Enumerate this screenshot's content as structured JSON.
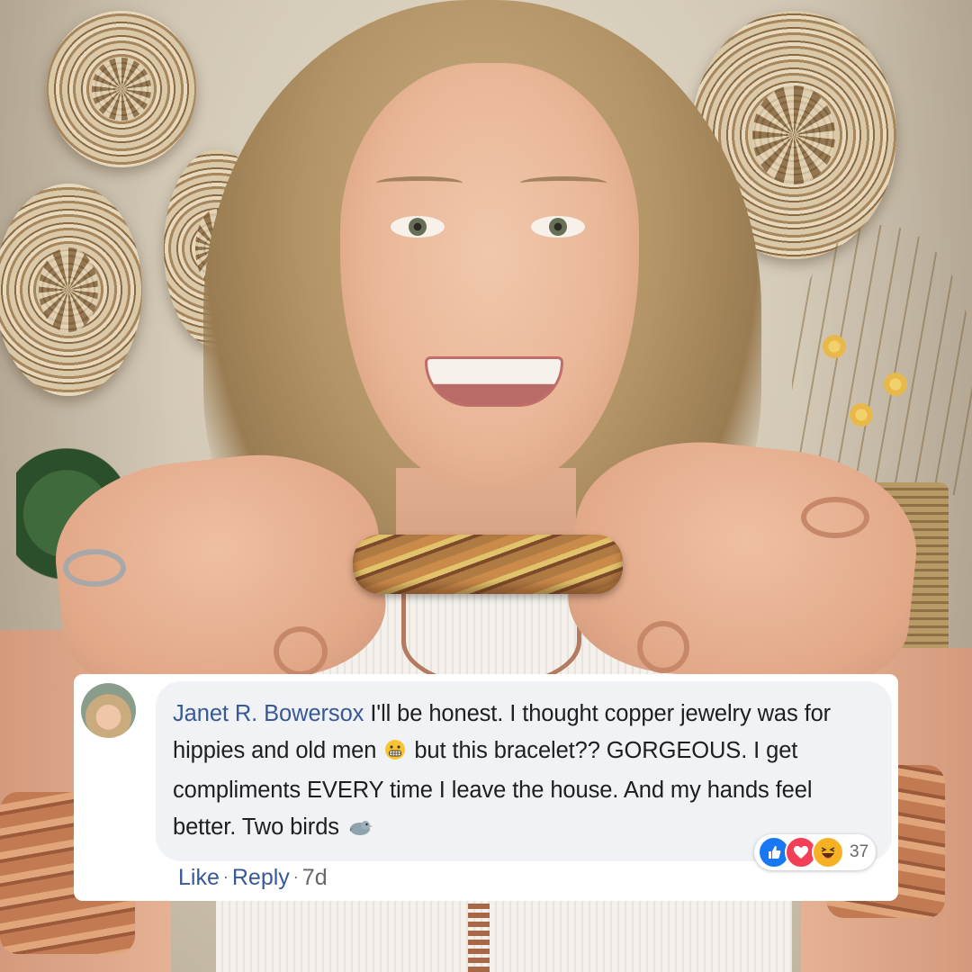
{
  "comment": {
    "author_name": "Janet R. Bowersox",
    "text_part1": "I'll be honest. I thought copper jewelry was for hippies and old men",
    "text_part2": "but this bracelet?? GORGEOUS. I get compliments EVERY time I leave the house. And my hands feel better. Two birds",
    "inline_emojis": [
      "grimacing-face",
      "bird"
    ],
    "reactions": {
      "icons": [
        "like",
        "love",
        "haha"
      ],
      "count": "37"
    },
    "actions": {
      "like_label": "Like",
      "reply_label": "Reply",
      "separator": "·",
      "time": "7d"
    }
  },
  "colors": {
    "author": "#385898",
    "link": "#385898",
    "meta": "#65676b",
    "bubble": "#f0f2f5",
    "like": "#1877f2",
    "love": "#f33e58",
    "haha": "#f7b125"
  }
}
